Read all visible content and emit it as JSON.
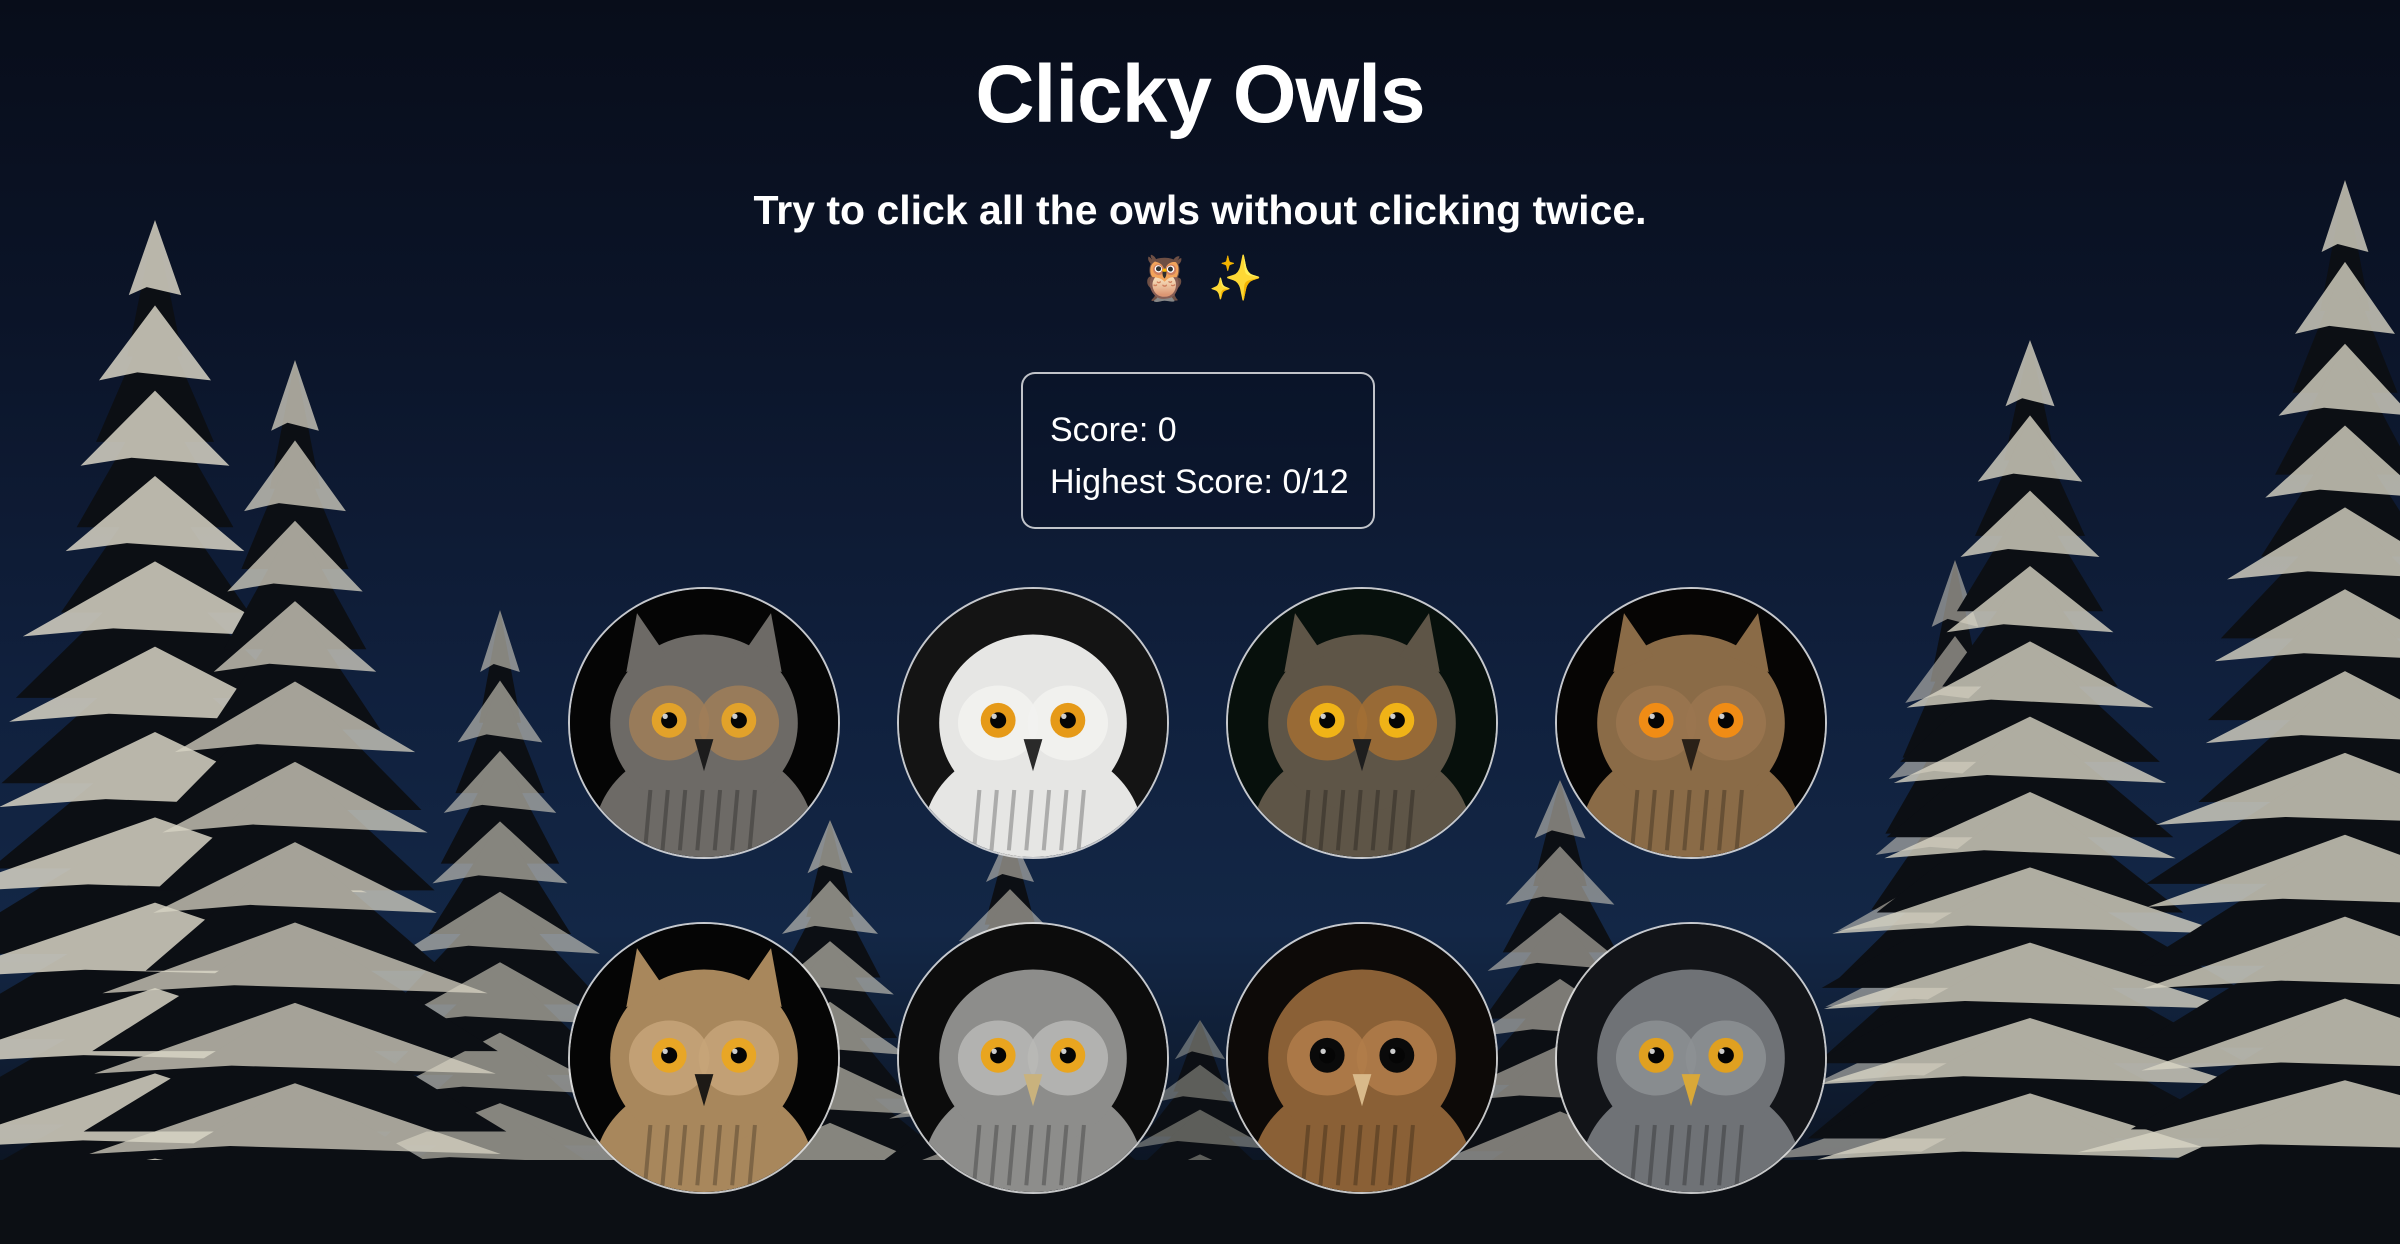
{
  "app": {
    "title": "Clicky Owls",
    "subtitle": "Try to click all the owls without clicking twice.",
    "emoji_owl": "🦉",
    "emoji_sparkles": "✨"
  },
  "scoreboard": {
    "score_label": "Score: 0",
    "highest_label": "Highest Score: 0/12"
  },
  "colors": {
    "sky_top": "#080d1a",
    "sky_mid": "#132746",
    "snow": "#d8d4c4",
    "tree_dark": "#0c0f14"
  },
  "owls": [
    {
      "name": "great-horned-owl",
      "bg": "#050505",
      "face": "#6d6a66",
      "disc": "#a07e58",
      "eye": "#e2a22a",
      "tufts": true,
      "beak": "#1c1c1c"
    },
    {
      "name": "snowy-owl",
      "bg": "#141414",
      "face": "#e6e6e4",
      "disc": "#f2f2f0",
      "eye": "#e69a18",
      "tufts": false,
      "beak": "#2a2a2a"
    },
    {
      "name": "long-eared-owl",
      "bg": "#07100c",
      "face": "#5e5547",
      "disc": "#a26f34",
      "eye": "#f0b317",
      "tufts": true,
      "beak": "#1e1e1e"
    },
    {
      "name": "eurasian-eagle-owl",
      "bg": "#060504",
      "face": "#8a6b47",
      "disc": "#9a7650",
      "eye": "#f08c15",
      "tufts": true,
      "beak": "#2a2118"
    },
    {
      "name": "eagle-owl-tawny",
      "bg": "#050505",
      "face": "#a8875c",
      "disc": "#c7a479",
      "eye": "#e8a625",
      "tufts": true,
      "beak": "#1d1a16"
    },
    {
      "name": "northern-hawk-owl",
      "bg": "#0c0c0c",
      "face": "#8d8d8b",
      "disc": "#b9b9b6",
      "eye": "#e9a51f",
      "tufts": false,
      "beak": "#c9b27d"
    },
    {
      "name": "tawny-owl",
      "bg": "#0d0a08",
      "face": "#8a6036",
      "disc": "#b07c4a",
      "eye": "#0a0a0a",
      "tufts": false,
      "beak": "#d8b98a"
    },
    {
      "name": "great-grey-owl",
      "bg": "#121418",
      "face": "#6f7276",
      "disc": "#8d9094",
      "eye": "#e0a020",
      "tufts": false,
      "beak": "#d9a838"
    }
  ]
}
